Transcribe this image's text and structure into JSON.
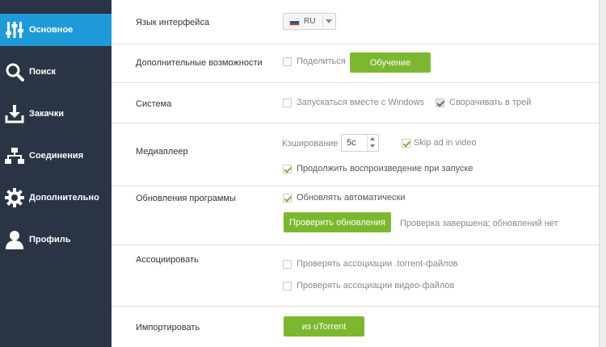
{
  "sidebar": {
    "items": [
      {
        "label": "Основное",
        "icon": "sliders-icon",
        "active": true
      },
      {
        "label": "Поиск",
        "icon": "search-icon",
        "active": false
      },
      {
        "label": "Закачки",
        "icon": "download-icon",
        "active": false
      },
      {
        "label": "Соединения",
        "icon": "network-icon",
        "active": false
      },
      {
        "label": "Дополнительно",
        "icon": "gear-icon",
        "active": false
      },
      {
        "label": "Профиль",
        "icon": "user-icon",
        "active": false
      }
    ],
    "background": "#2a3444",
    "active_color": "#1e9ad8"
  },
  "settings": {
    "language": {
      "label": "Язык интерфейса",
      "value": "RU"
    },
    "extras": {
      "label": "Дополнительные возможности",
      "share_label": "Поделиться",
      "share_checked": false,
      "tutorial_button": "Обучение"
    },
    "system": {
      "label": "Система",
      "autostart_label": "Запускаться вместе с Windows",
      "autostart_checked": false,
      "tray_label": "Сворачивать в трей",
      "tray_checked": true
    },
    "media": {
      "label": "Медиаплеер",
      "caching_label": "Кэширование",
      "caching_value": "5с",
      "skip_ad_label": "Skip ad in video",
      "skip_ad_checked": true,
      "resume_label": "Продолжить воспроизведение при запуске",
      "resume_checked": true
    },
    "updates": {
      "label": "Обновления программы",
      "auto_label": "Обновлять автоматически",
      "auto_checked": true,
      "check_button": "Проверить обновления",
      "status": "Проверка завершена; обновлений нет"
    },
    "associate": {
      "label": "Ассоциировать",
      "torrent_label": "Проверять ассоциации .torrent-файлов",
      "torrent_checked": false,
      "video_label": "Проверять ассоциации видео-файлов",
      "video_checked": false
    },
    "import": {
      "label": "Импортировать",
      "button": "из uTorrent"
    }
  },
  "colors": {
    "accent_green": "#7cb82f"
  }
}
